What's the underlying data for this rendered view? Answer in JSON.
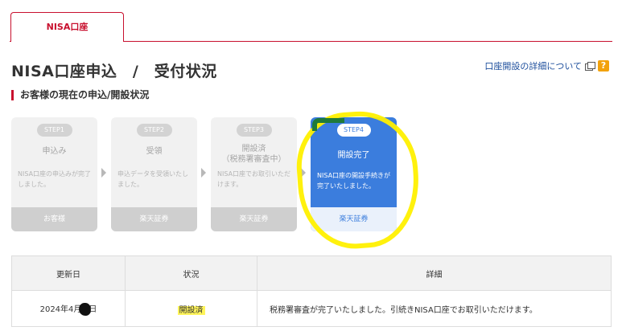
{
  "tabs": [
    {
      "label": "NISA口座"
    }
  ],
  "page": {
    "title": "NISA口座申込　/　受付状況",
    "detail_link": "口座開設の詳細について",
    "help_icon": "?"
  },
  "section_title": "お客様の現在の申込/開設状況",
  "steps": [
    {
      "badge": "STEP1",
      "title": "申込み",
      "description": "NISA口座の申込みが完了しました。",
      "actor": "お客様",
      "active": false
    },
    {
      "badge": "STEP2",
      "title": "受領",
      "description": "申込データを受領いたしました。",
      "actor": "楽天証券",
      "active": false
    },
    {
      "badge": "STEP3",
      "title": "開設済\n（税務署審査中）",
      "description": "NISA口座でお取引いただけます。",
      "actor": "楽天証券",
      "active": false
    },
    {
      "badge": "STEP4",
      "title": "開設完了",
      "description": "NISA口座の開設手続きが完了いたしました。",
      "actor": "楽天証券",
      "active": true
    }
  ],
  "table": {
    "headers": [
      "更新日",
      "状況",
      "詳細"
    ],
    "rows": [
      {
        "date_prefix": "2024年4月",
        "date_suffix": "日",
        "status": "開設済",
        "detail": "税務署審査が完了いたしました。引続きNISA口座でお取引いただけます。"
      }
    ]
  },
  "colors": {
    "brand_red": "#c8102e",
    "active_blue": "#3b7ddd",
    "annotation_yellow": "#fff000"
  }
}
